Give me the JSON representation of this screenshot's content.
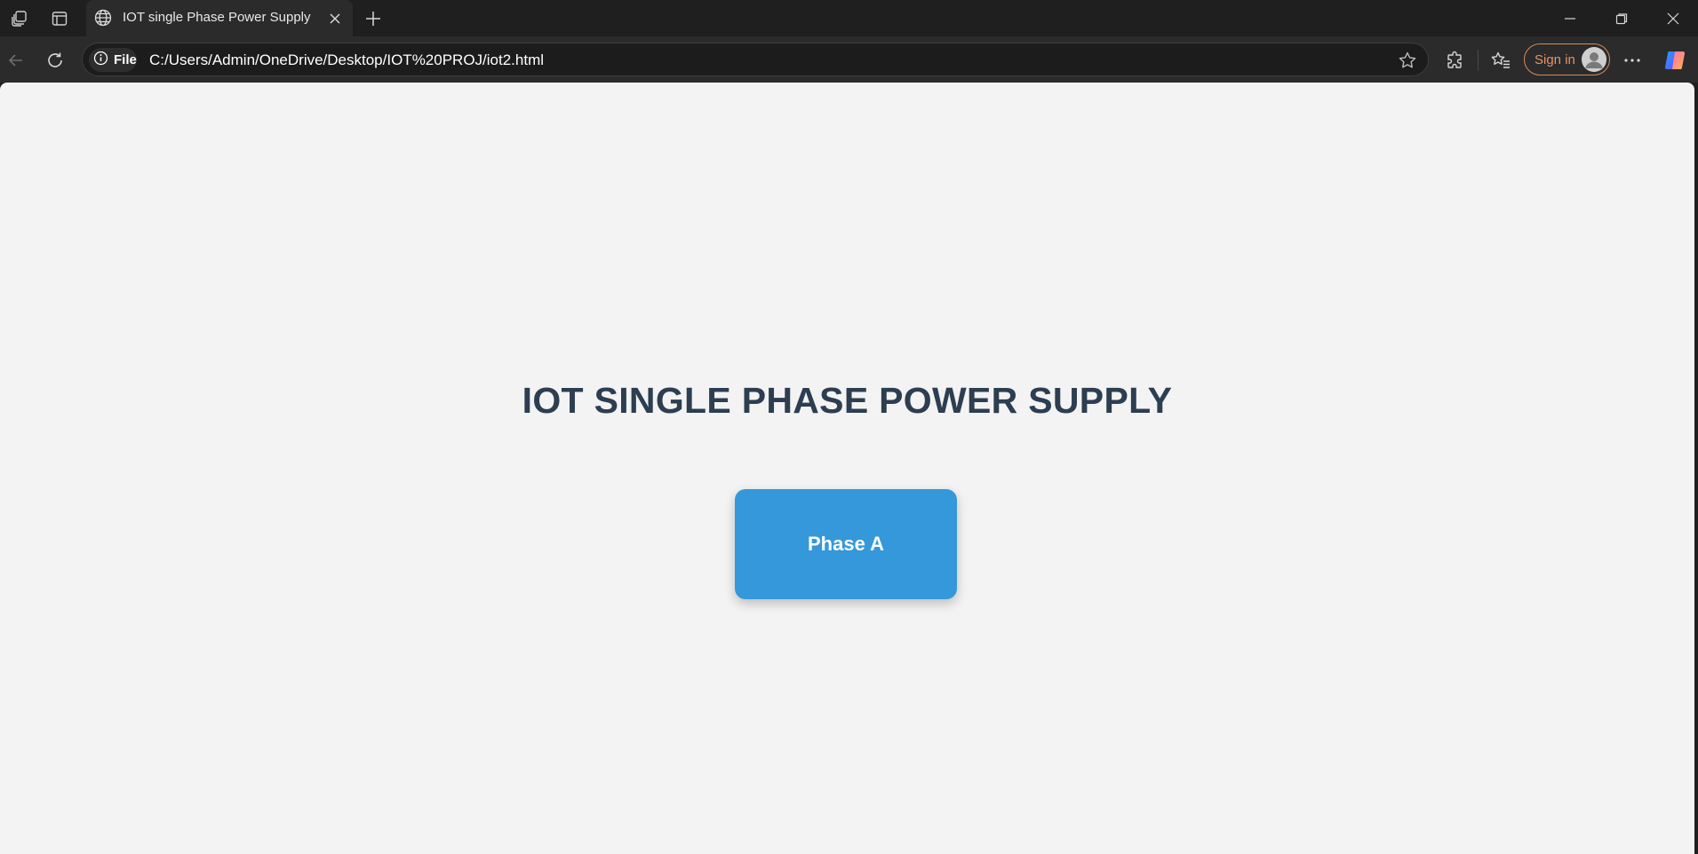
{
  "browser": {
    "tab": {
      "title": "IOT single Phase Power Supply",
      "icon": "globe-icon"
    },
    "address_bar": {
      "site_info_label": "File",
      "url": "C:/Users/Admin/OneDrive/Desktop/IOT%20PROJ/iot2.html"
    },
    "sign_in_label": "Sign in",
    "icons": {
      "workspaces": "workspaces-icon",
      "tab_actions": "tab-actions-icon",
      "new_tab": "plus-icon",
      "minimize": "minimize-icon",
      "restore": "restore-icon",
      "close": "close-icon",
      "back": "back-arrow-icon",
      "reload": "reload-icon",
      "favorite": "star-icon",
      "extensions": "puzzle-icon",
      "favorites": "favorites-icon",
      "more": "more-icon",
      "copilot": "copilot-icon"
    },
    "colors": {
      "chrome_bg": "#1f1f1f",
      "toolbar_bg": "#2b2b2b",
      "signin_accent": "#e39467"
    }
  },
  "page": {
    "heading": "IOT SINGLE PHASE POWER SUPPLY",
    "button_label": "Phase A",
    "colors": {
      "background": "#f3f3f3",
      "heading": "#2c3e50",
      "button": "#3498db",
      "button_text": "#ffffff"
    }
  }
}
